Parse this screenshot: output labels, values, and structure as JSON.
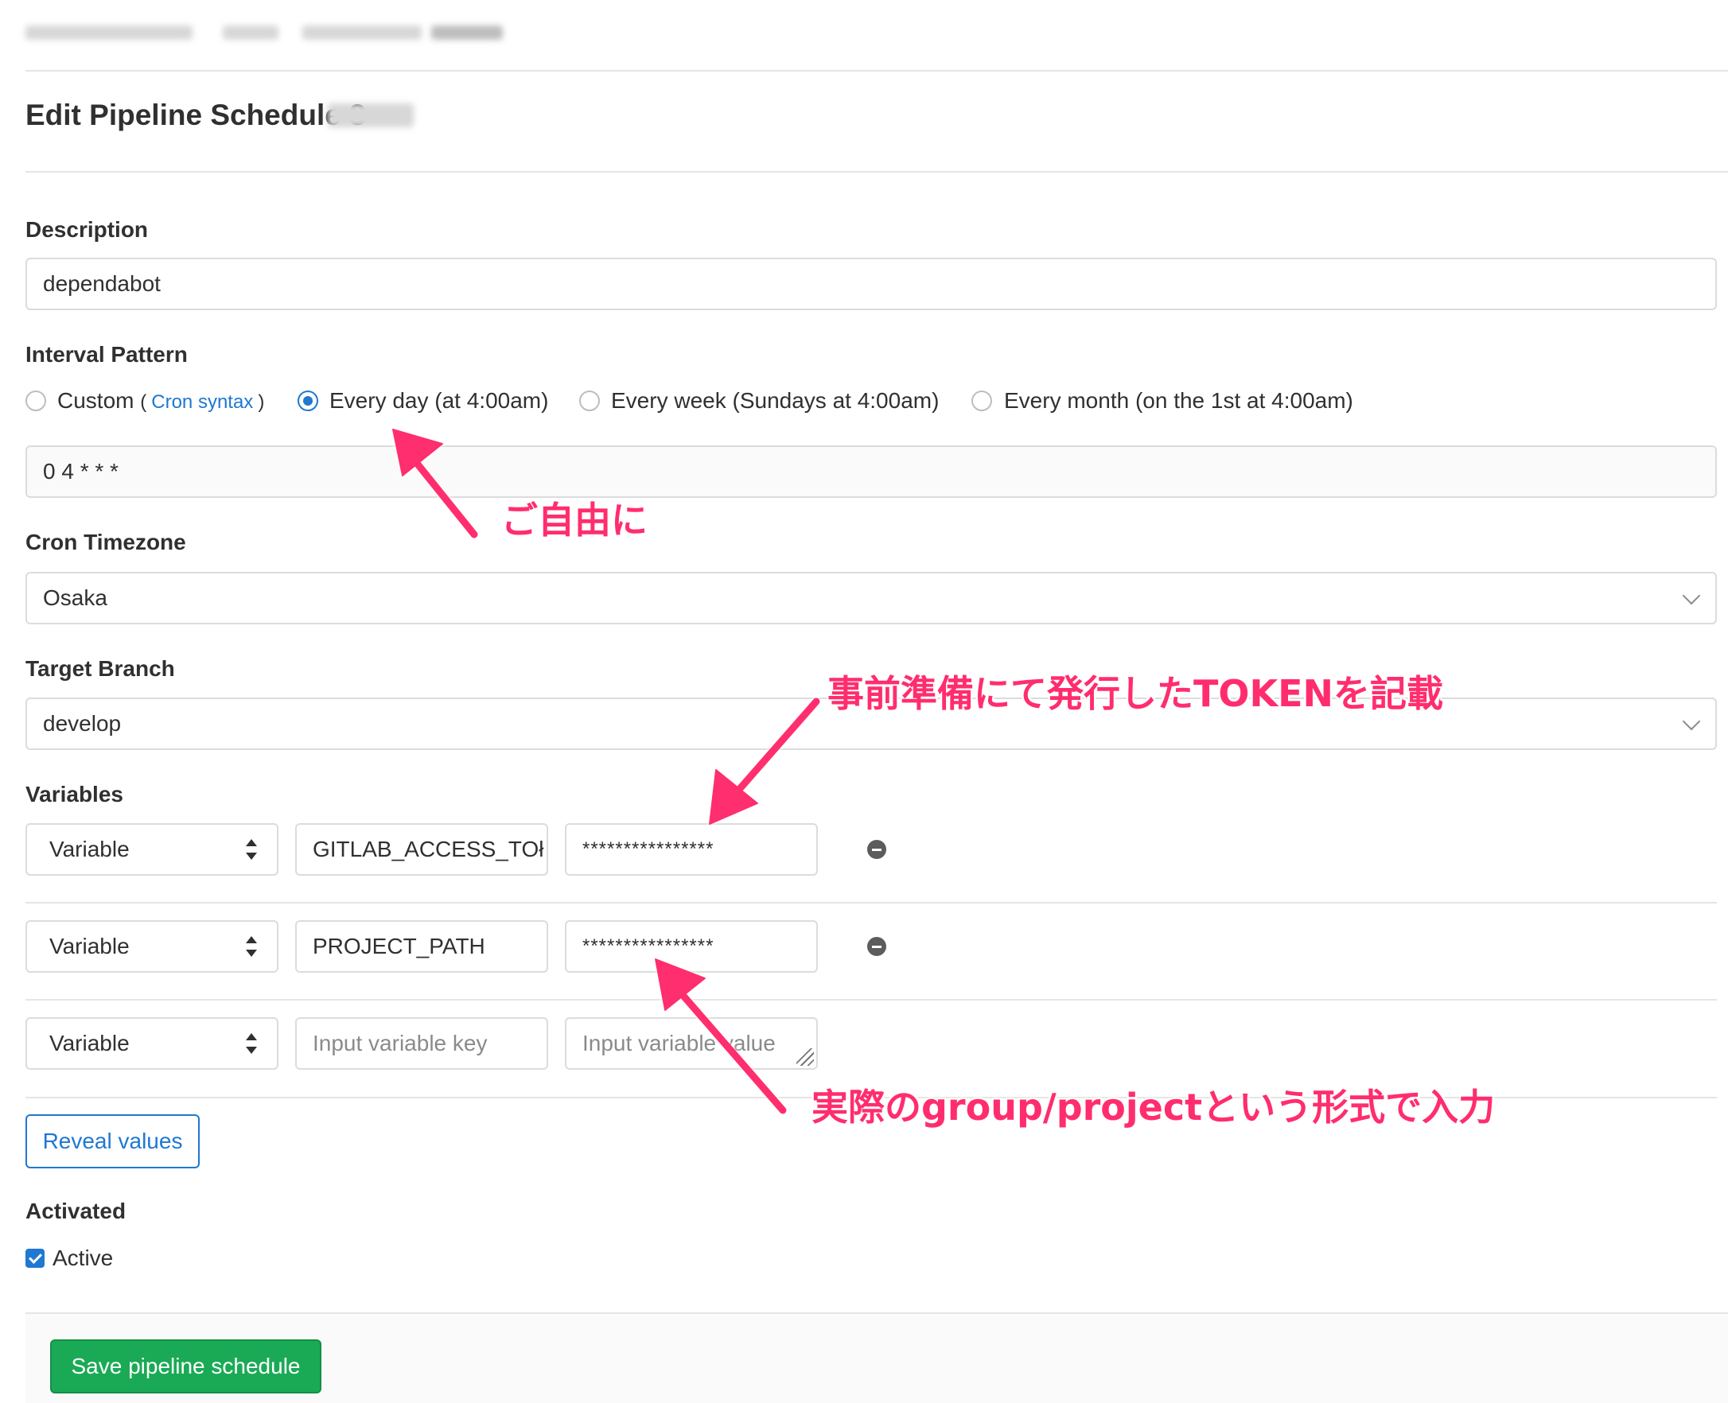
{
  "breadcrumb_visible": "",
  "page": {
    "title": "Edit Pipeline Schedule 3"
  },
  "form": {
    "description": {
      "label": "Description",
      "value": "dependabot"
    },
    "interval": {
      "label": "Interval Pattern",
      "custom_label": "Custom",
      "paren_open": "(",
      "cron_link": "Cron syntax",
      "paren_close": ")",
      "options": [
        "Every day (at 4:00am)",
        "Every week (Sundays at 4:00am)",
        "Every month (on the 1st at 4:00am)"
      ],
      "selected": "Every day (at 4:00am)",
      "cron_value": "0 4 * * *"
    },
    "timezone": {
      "label": "Cron Timezone",
      "value": "Osaka"
    },
    "branch": {
      "label": "Target Branch",
      "value": "develop"
    },
    "variables": {
      "label": "Variables",
      "rows": [
        {
          "type": "Variable",
          "key": "GITLAB_ACCESS_TOł",
          "value": "****************"
        },
        {
          "type": "Variable",
          "key": "PROJECT_PATH",
          "value": "****************"
        },
        {
          "type": "Variable",
          "key_placeholder": "Input variable key",
          "value_placeholder": "Input variable value"
        }
      ]
    },
    "reveal_button": "Reveal values",
    "activated": {
      "label": "Activated",
      "checkbox_label": "Active",
      "checked": true
    },
    "save_button": "Save pipeline schedule"
  },
  "annotations": {
    "a1": "ご自由に",
    "a2": "事前準備にて発行したTOKENを記載",
    "a3": "実際のgroup/projectという形式で入力"
  },
  "colors": {
    "accent": "#1f78d1",
    "success": "#1aaa55",
    "annotation": "#ff2d6e"
  }
}
